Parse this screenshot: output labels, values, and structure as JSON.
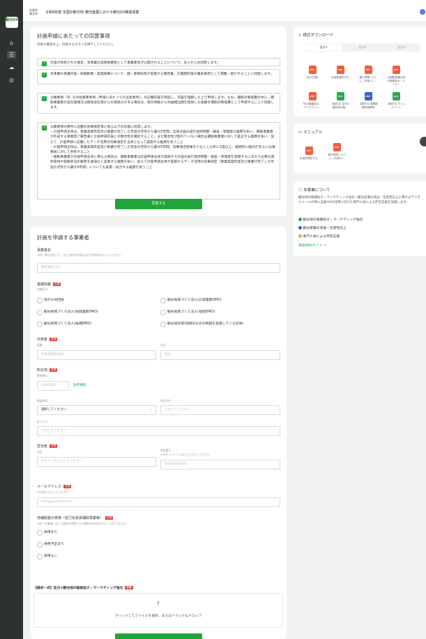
{
  "app": {
    "logo_text": "観光DX",
    "brand_line1": "計画申",
    "brand_line2": "請主体",
    "title": "令和8年度 全国の観光地･観光産業における観光DX推進事業"
  },
  "rail": [
    "home-icon",
    "list-icon",
    "cloud-icon",
    "user-icon"
  ],
  "agreement": {
    "title": "計画申請にあたっての同意事項",
    "subtitle": "内容を確認の上、同意するボタンを押下してください。",
    "items": [
      "計画が採択された場合、本事業の実施事業者として事業者名が公開されることについて、あらかじめ同意します。",
      "本事業の事業内容・取組概要・実施結果について、国・事務局等が実施する報告書、広報資料等の優良事例として掲載・紹介することに同意します。",
      "公募要領「Ⅵ. その他重要事項（申請にあたっての注意事項）」の記載内容を熟読し、内容を理解した上で申請します。なお、補助対象経費の中に、補助事業者の自社調達又は関係会社等からの調達分がある場合は、取引価格から利益相当額を控除した金額を補助対象経費として申請することに同意します。",
      "公募要領の要件に記載の効果測定等に係る以下の内容に同意します。\n・計画申請主体は、事業実施年度及び事業が完了した年度の翌年から最大5年間、全体計画の遂行進捗把握・検査・管理等の義務を負い、補助事業者が作成する事業完了報告書と計画申請内容との整合性を確認すること。また整合性が取れていない場合は補助事業者に対して是正する義務を負い、加えて、計画申請に記載したデータ活用の効果測定を主体となって実施する義務を負うこと\n・計画申請主体は、事業実施年度及び事業が完了した年度の翌年から最大5年間、効果測定結果を少なくとも年に1度以上、継続的に観光庁あるいは事務局に対して共有すること\n・補助事業者が計画申請主体と異なる場合は、補助事業者は計画申請主体が実施する計画の遂行進捗把握・検査・管理等を実施するにあたり必要な資料提供や取組状況の報告を遅滞なく実施する義務を負い、加えて計画申請主体が実施するデータ活用の効果測定（事業実施年度及び事業が完了した年度の翌年から最大5年間）についても実施・協力する義務を負うこと"
    ],
    "agree_button": "同意する"
  },
  "form": {
    "title": "計画を申請する事業者",
    "company_label": "事業者名",
    "company_note": "※例）株式会社〇〇、など会社名の場合は正式名称を記入してください",
    "company_placeholder": "株式会社〇〇",
    "basic_label": "基礎情報",
    "required": "必須",
    "type_label": "組織区分",
    "org_types": [
      "地方公共団体",
      "観光地域づくり法人(広域連携DMO)",
      "観光地域づくり法人(地域連携DMO)",
      "観光地域づくり法人(地域DMO)",
      "観光地域づくり法人(候補DMO)",
      "観光協会等(地域のための取組を実施している主体)"
    ],
    "rep_label": "代表者",
    "role_label": "役職",
    "role_placeholder": "代表取締役社長",
    "name_label": "氏名",
    "name_placeholder": "氏名",
    "address_label": "所在地",
    "zip_label": "郵便番号",
    "zip_placeholder": "0000000",
    "zip_search": "住所検索",
    "pref_label": "都道府県",
    "pref_value": "選択してください",
    "city_label": "市区町村",
    "city_placeholder": "入力してください",
    "street_label": "町丁以下",
    "street_placeholder": "入力してください",
    "contact_label": "担当者",
    "contact_name_label": "氏名",
    "contact_name_placeholder": "テキストを入力してください",
    "phone_label": "電話番号",
    "phone_note": "※市外・ハイフンなしで入力してください",
    "phone_placeholder": "00000000000",
    "email_label": "メールアドレス",
    "email_note": "※半角で入力してください",
    "email_placeholder": "mail@example.com",
    "subsidy_label": "他補助金の併用（省力化投資補助事業等）",
    "subsidy_note": "※同一の事業に対して国費を財源とする補助金を併用することはできません",
    "subsidy_options": [
      "併用あり",
      "併用予定あり",
      "併用なし"
    ],
    "upload_label": "【様式一式】区分①観光地の販路拡大・マーケティング強化",
    "upload_text": "クリックしてファイルを選択、またはドラッグ＆ドロップ"
  },
  "downloads": {
    "title": "様式ダウンロード",
    "tabs": [
      "区分1",
      "区分2",
      "区分3"
    ],
    "items": [
      {
        "label": "FAQ(共通)",
        "icon": "pdf-icon",
        "color": "#f25c3e"
      },
      {
        "label": "計画申請手引き",
        "icon": "pdf-icon",
        "color": "#f25c3e"
      },
      {
        "label": "電子申請システム ご利用マニ…",
        "icon": "pdf-icon",
        "color": "#f25c3e"
      },
      {
        "label": "公募要領(観光地の販路拡大・マーケ…",
        "icon": "pdf-icon",
        "color": "#f25c3e"
      },
      {
        "label": "FAQ(販路拡大・マーケティン…",
        "icon": "pdf-icon",
        "color": "#f25c3e"
      },
      {
        "label": "【様式2】区分①観光地の販…",
        "icon": "excel-icon",
        "color": "#2ea64a"
      },
      {
        "label": "【様式3】事業費概算見積書",
        "icon": "word-icon",
        "color": "#3b62c9"
      },
      {
        "label": "【様式3】チェックシート",
        "icon": "excel-icon",
        "color": "#2ea64a"
      }
    ]
  },
  "manual": {
    "title": "マニュアル",
    "items": [
      {
        "label": "計画申請手引き"
      },
      {
        "label": "電子申請システム ご利用マ…"
      }
    ]
  },
  "about": {
    "title": "本事業について",
    "text": "観光地の販路拡大・マーケティング強化 / 観光産業の収益・生産性向上に資するデジタルツールの導入支援やDX活用に向けた専門人材による伴走支援を実施します。",
    "bullets": [
      {
        "text": "観光地の販路拡大・マーケティング強化",
        "color": "#2ea64a"
      },
      {
        "text": "観光産業の収益・生産性向上",
        "color": "#3b62c9"
      },
      {
        "text": "専門人材による伴走支援",
        "color": "#f2a93b"
      }
    ],
    "link": "特設Webサイト"
  }
}
